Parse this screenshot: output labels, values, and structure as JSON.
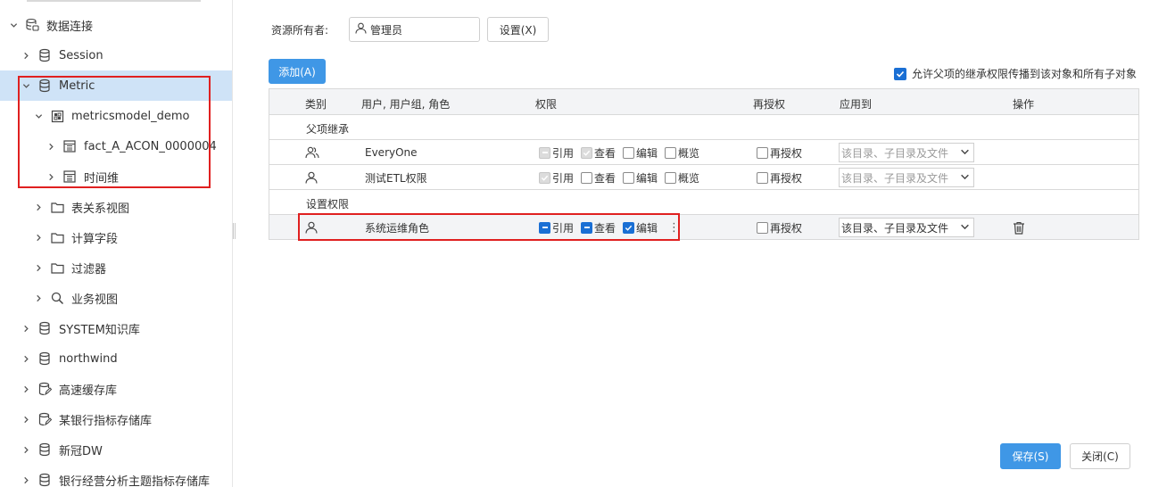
{
  "sidebar": {
    "items": [
      {
        "label": "数据连接",
        "icon": "database-group-icon",
        "expanded": true
      },
      {
        "label": "Session",
        "icon": "database-icon",
        "expanded": false
      },
      {
        "label": "Metric",
        "icon": "database-icon",
        "expanded": true,
        "selected": true
      },
      {
        "label": "metricsmodel_demo",
        "icon": "model-icon",
        "expanded": true
      },
      {
        "label": "fact_A_ACON_0000004",
        "icon": "table-icon",
        "expanded": false
      },
      {
        "label": "时间维",
        "icon": "table-icon",
        "expanded": false
      },
      {
        "label": "表关系视图",
        "icon": "folder-icon",
        "expanded": false
      },
      {
        "label": "计算字段",
        "icon": "folder-icon",
        "expanded": false
      },
      {
        "label": "过滤器",
        "icon": "folder-icon",
        "expanded": false
      },
      {
        "label": "业务视图",
        "icon": "search-icon",
        "expanded": false
      },
      {
        "label": "SYSTEM知识库",
        "icon": "database-icon",
        "expanded": false
      },
      {
        "label": "northwind",
        "icon": "database-icon",
        "expanded": false
      },
      {
        "label": "高速缓存库",
        "icon": "database-edit-icon",
        "expanded": false
      },
      {
        "label": "某银行指标存储库",
        "icon": "database-edit-icon",
        "expanded": false
      },
      {
        "label": "新冠DW",
        "icon": "database-icon",
        "expanded": false
      },
      {
        "label": "银行经营分析主题指标存储库",
        "icon": "database-icon",
        "expanded": false
      }
    ]
  },
  "owner": {
    "label": "资源所有者:",
    "value": "管理员",
    "settings_button": "设置(X)"
  },
  "toolbar": {
    "add_button": "添加(A)",
    "inherit_label": "允许父项的继承权限传播到该对象和所有子对象",
    "inherit_checked": true
  },
  "table": {
    "headers": {
      "type": "类别",
      "principal": "用户, 用户组, 角色",
      "permission": "权限",
      "regrant": "再授权",
      "apply_to": "应用到",
      "actions": "操作"
    },
    "group_inherited": "父项继承",
    "group_set": "设置权限",
    "rows": [
      {
        "type_icon": "group-icon",
        "name": "EveryOne",
        "perms": {
          "ref": "引用",
          "view": "查看",
          "edit": "编辑",
          "browse": "概览"
        },
        "regrant": "再授权",
        "apply_to": "该目录、子目录及文件"
      },
      {
        "type_icon": "user-icon",
        "name": "测试ETL权限",
        "perms": {
          "ref": "引用",
          "view": "查看",
          "edit": "编辑",
          "browse": "概览"
        },
        "regrant": "再授权",
        "apply_to": "该目录、子目录及文件"
      },
      {
        "type_icon": "user-icon",
        "name": "系统运维角色",
        "perms": {
          "ref": "引用",
          "view": "查看",
          "edit": "编辑"
        },
        "regrant": "再授权",
        "apply_to": "该目录、子目录及文件",
        "more": "⋮"
      }
    ]
  },
  "footer": {
    "save_button": "保存(S)",
    "close_button": "关闭(C)"
  },
  "colors": {
    "primary": "#3f97e6",
    "selected_row": "#cfe3f7",
    "highlight_box": "#e02020",
    "checkbox_blue": "#1a6fd4"
  }
}
